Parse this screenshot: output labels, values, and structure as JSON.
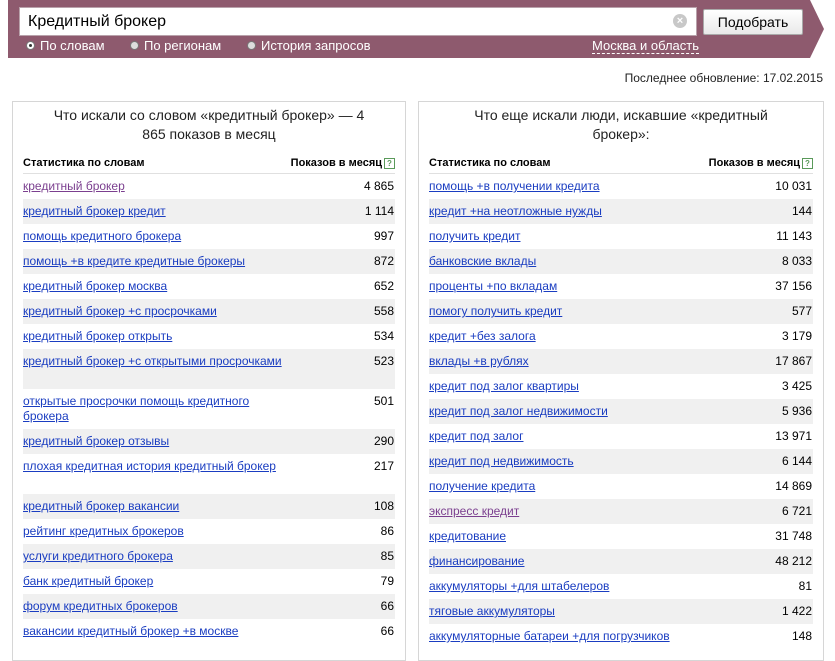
{
  "search": {
    "query": "Кредитный брокер",
    "submit_label": "Подобрать",
    "clear_symbol": "×",
    "modes": [
      {
        "label": "По словам",
        "checked": true
      },
      {
        "label": "По регионам",
        "checked": false
      },
      {
        "label": "История запросов",
        "checked": false
      }
    ],
    "region": "Москва и область"
  },
  "last_update": "Последнее обновление: 17.02.2015",
  "left_panel": {
    "title": "Что искали со словом «кредитный брокер» — 4 865 показов в месяц",
    "col_keyword": "Статистика по словам",
    "col_shows": "Показов в месяц",
    "help_symbol": "?",
    "rows": [
      {
        "phrase": "кредитный брокер",
        "shows": "4 865"
      },
      {
        "phrase": "кредитный брокер кредит",
        "shows": "1 114"
      },
      {
        "phrase": "помощь кредитного брокера",
        "shows": "997"
      },
      {
        "phrase": "помощь +в кредите кредитные брокеры",
        "shows": "872"
      },
      {
        "phrase": "кредитный брокер москва",
        "shows": "652"
      },
      {
        "phrase": "кредитный брокер +с просрочками",
        "shows": "558"
      },
      {
        "phrase": "кредитный брокер открыть",
        "shows": "534"
      },
      {
        "phrase": "кредитный брокер +с открытыми просрочками",
        "shows": "523"
      },
      {
        "phrase": "открытые просрочки помощь кредитного брокера",
        "shows": "501"
      },
      {
        "phrase": "кредитный брокер отзывы",
        "shows": "290"
      },
      {
        "phrase": "плохая кредитная история кредитный брокер",
        "shows": "217"
      },
      {
        "phrase": "кредитный брокер вакансии",
        "shows": "108"
      },
      {
        "phrase": "рейтинг кредитных брокеров",
        "shows": "86"
      },
      {
        "phrase": "услуги кредитного брокера",
        "shows": "85"
      },
      {
        "phrase": "банк кредитный брокер",
        "shows": "79"
      },
      {
        "phrase": "форум кредитных брокеров",
        "shows": "66"
      },
      {
        "phrase": "вакансии кредитный брокер +в москве",
        "shows": "66"
      }
    ]
  },
  "right_panel": {
    "title": "Что еще искали люди, искавшие «кредитный брокер»:",
    "col_keyword": "Статистика по словам",
    "col_shows": "Показов в месяц",
    "help_symbol": "?",
    "rows": [
      {
        "phrase": "помощь +в получении кредита",
        "shows": "10 031"
      },
      {
        "phrase": "кредит +на неотложные нужды",
        "shows": "144"
      },
      {
        "phrase": "получить кредит",
        "shows": "11 143"
      },
      {
        "phrase": "банковские вклады",
        "shows": "8 033"
      },
      {
        "phrase": "проценты +по вкладам",
        "shows": "37 156"
      },
      {
        "phrase": "помогу получить кредит",
        "shows": "577"
      },
      {
        "phrase": "кредит +без залога",
        "shows": "3 179"
      },
      {
        "phrase": "вклады +в рублях",
        "shows": "17 867"
      },
      {
        "phrase": "кредит под залог квартиры",
        "shows": "3 425"
      },
      {
        "phrase": "кредит под залог недвижимости",
        "shows": "5 936"
      },
      {
        "phrase": "кредит под залог",
        "shows": "13 971"
      },
      {
        "phrase": "кредит под недвижимость",
        "shows": "6 144"
      },
      {
        "phrase": "получение кредита",
        "shows": "14 869"
      },
      {
        "phrase": "экспресс кредит",
        "shows": "6 721"
      },
      {
        "phrase": "кредитование",
        "shows": "31 748"
      },
      {
        "phrase": "финансирование",
        "shows": "48 212"
      },
      {
        "phrase": "аккумуляторы +для штабелеров",
        "shows": "81"
      },
      {
        "phrase": "тяговые аккумуляторы",
        "shows": "1 422"
      },
      {
        "phrase": "аккумуляторные батареи +для погрузчиков",
        "shows": "148"
      }
    ]
  },
  "colors": {
    "header_bg": "#8e5a6e",
    "link": "#1a3dc1",
    "visited_link": "#7b3f8f",
    "zebra": "#f0f0f0"
  }
}
